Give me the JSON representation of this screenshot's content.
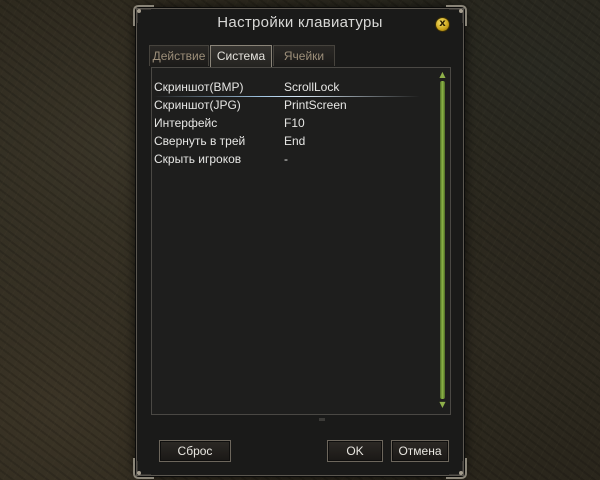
{
  "window": {
    "title": "Настройки клавиатуры",
    "close_label": "x"
  },
  "tabs": [
    {
      "label": "Действие",
      "active": false
    },
    {
      "label": "Система",
      "active": true
    },
    {
      "label": "Ячейки",
      "active": false
    }
  ],
  "hotkeys": {
    "rows": [
      {
        "name": "Скриншот(BMP)",
        "key": "ScrollLock",
        "selected": true
      },
      {
        "name": "Скриншот(JPG)",
        "key": "PrintScreen",
        "selected": false
      },
      {
        "name": "Интерфейс",
        "key": "F10",
        "selected": false
      },
      {
        "name": "Свернуть в трей",
        "key": "End",
        "selected": false
      },
      {
        "name": "Скрыть игроков",
        "key": "-",
        "selected": false
      }
    ]
  },
  "buttons": {
    "reset_label": "Сброс",
    "ok_label": "OK",
    "cancel_label": "Отмена"
  },
  "colors": {
    "scrollbar": "#8db548",
    "selection_glow": "#9ec2e0",
    "close_button": "#f7e36a"
  }
}
